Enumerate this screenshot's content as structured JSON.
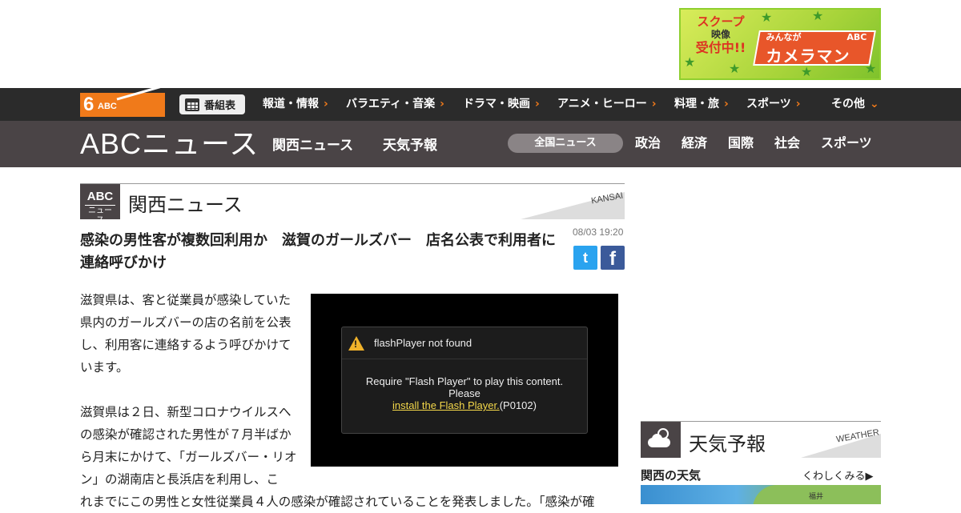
{
  "ad": {
    "left_line1": "スクープ",
    "left_line2": "映像",
    "left_line3": "受付中!!",
    "right_small": "みんなが",
    "right_abc": "ABC",
    "right_main": "カメラマン"
  },
  "topnav": {
    "logo_six": "6",
    "logo_abc": "ABC",
    "program_button": "番組表",
    "items": [
      "報道・情報",
      "バラエティ・音楽",
      "ドラマ・映画",
      "アニメ・ヒーロー",
      "料理・旅",
      "スポーツ",
      "その他"
    ]
  },
  "newsbar": {
    "logo": "ABCニュース",
    "links": [
      "関西ニュース",
      "天気予報"
    ],
    "active_pill": "全国ニュース",
    "categories": [
      "政治",
      "経済",
      "国際",
      "社会",
      "スポーツ"
    ]
  },
  "section": {
    "badge_top": "ABC",
    "badge_bottom": "ニュース",
    "title": "関西ニュース",
    "en": "KANSAI"
  },
  "article": {
    "headline": "感染の男性客が複数回利用か　滋賀のガールズバー　店名公表で利用者に連絡呼びかけ",
    "date": "08/03 19:20",
    "paragraphs": [
      "滋賀県は、客と従業員が感染していた県内のガールズバーの店の名前を公表し、利用客に連絡するよう呼びかけています。",
      "滋賀県は２日、新型コロナウイルスへの感染が確認された男性が７月半ばから月末にかけて、「ガールズバー・リオン」の湖南店と長浜店を利用し、こ"
    ],
    "continued": "れまでにこの男性と女性従業員４人の感染が確認されていることを発表しました。「感染が確"
  },
  "share": {
    "twitter_glyph": "t",
    "facebook_glyph": "f"
  },
  "player": {
    "dialog_title": "flashPlayer not found",
    "line1": "Require \"Flash Player\" to play this content.",
    "line2": "Please",
    "link": "install the Flash Player.",
    "code": "(P0102)"
  },
  "weather": {
    "title": "天気予報",
    "en": "WEATHER",
    "subtitle": "関西の天気",
    "more": "くわしくみる▶",
    "map_city": "福井"
  },
  "colors": {
    "accent_orange": "#f07a1a",
    "nav_dark": "#2b2b2b",
    "news_bar": "#4a4446",
    "twitter": "#2aa3ef",
    "facebook": "#3b5a9a",
    "warning": "#f0b22a"
  }
}
